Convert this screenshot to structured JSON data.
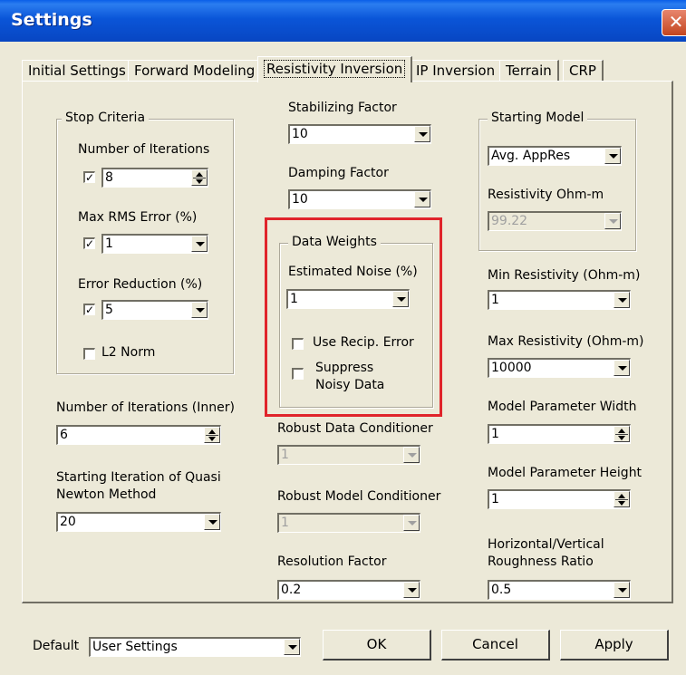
{
  "window": {
    "title": "Settings",
    "close_glyph": "✕"
  },
  "tabs": [
    {
      "label": "Initial Settings"
    },
    {
      "label": "Forward Modeling"
    },
    {
      "label": "Resistivity Inversion"
    },
    {
      "label": "IP Inversion"
    },
    {
      "label": "Terrain"
    },
    {
      "label": "CRP"
    }
  ],
  "stop_criteria": {
    "legend": "Stop Criteria",
    "iterations_label": "Number of Iterations",
    "iterations_value": "8",
    "iterations_checked": true,
    "rms_label": "Max RMS Error (%)",
    "rms_value": "1",
    "rms_checked": true,
    "reduction_label": "Error Reduction (%)",
    "reduction_value": "5",
    "reduction_checked": true,
    "l2_label": "L2 Norm",
    "l2_checked": false
  },
  "inner_iterations": {
    "label": "Number of Iterations (Inner)",
    "value": "6"
  },
  "quasi_newton": {
    "label_line1": "Starting Iteration of Quasi",
    "label_line2": "Newton Method",
    "value": "20"
  },
  "stabilizing": {
    "label": "Stabilizing Factor",
    "value": "10"
  },
  "damping": {
    "label": "Damping Factor",
    "value": "10"
  },
  "data_weights": {
    "legend": "Data Weights",
    "noise_label": "Estimated Noise (%)",
    "noise_value": "1",
    "recip_label": "Use Recip. Error",
    "recip_checked": false,
    "suppress_line1": "Suppress",
    "suppress_line2": "Noisy Data",
    "suppress_checked": false
  },
  "robust_data": {
    "label": "Robust Data Conditioner",
    "value": "1"
  },
  "robust_model": {
    "label": "Robust Model Conditioner",
    "value": "1"
  },
  "resolution": {
    "label": "Resolution Factor",
    "value": "0.2"
  },
  "starting_model": {
    "legend": "Starting Model",
    "value": "Avg. AppRes",
    "resistivity_label": "Resistivity Ohm-m",
    "resistivity_value": "99.22"
  },
  "min_res": {
    "label": "Min Resistivity (Ohm-m)",
    "value": "1"
  },
  "max_res": {
    "label": "Max Resistivity (Ohm-m)",
    "value": "10000"
  },
  "param_width": {
    "label": "Model Parameter Width",
    "value": "1"
  },
  "param_height": {
    "label": "Model Parameter Height",
    "value": "1"
  },
  "roughness": {
    "label_line1": "Horizontal/Vertical",
    "label_line2": "Roughness Ratio",
    "value": "0.5"
  },
  "footer": {
    "default_label": "Default",
    "default_value": "User Settings",
    "ok": "OK",
    "cancel": "Cancel",
    "apply": "Apply"
  },
  "highlight_color": "#e0242b"
}
